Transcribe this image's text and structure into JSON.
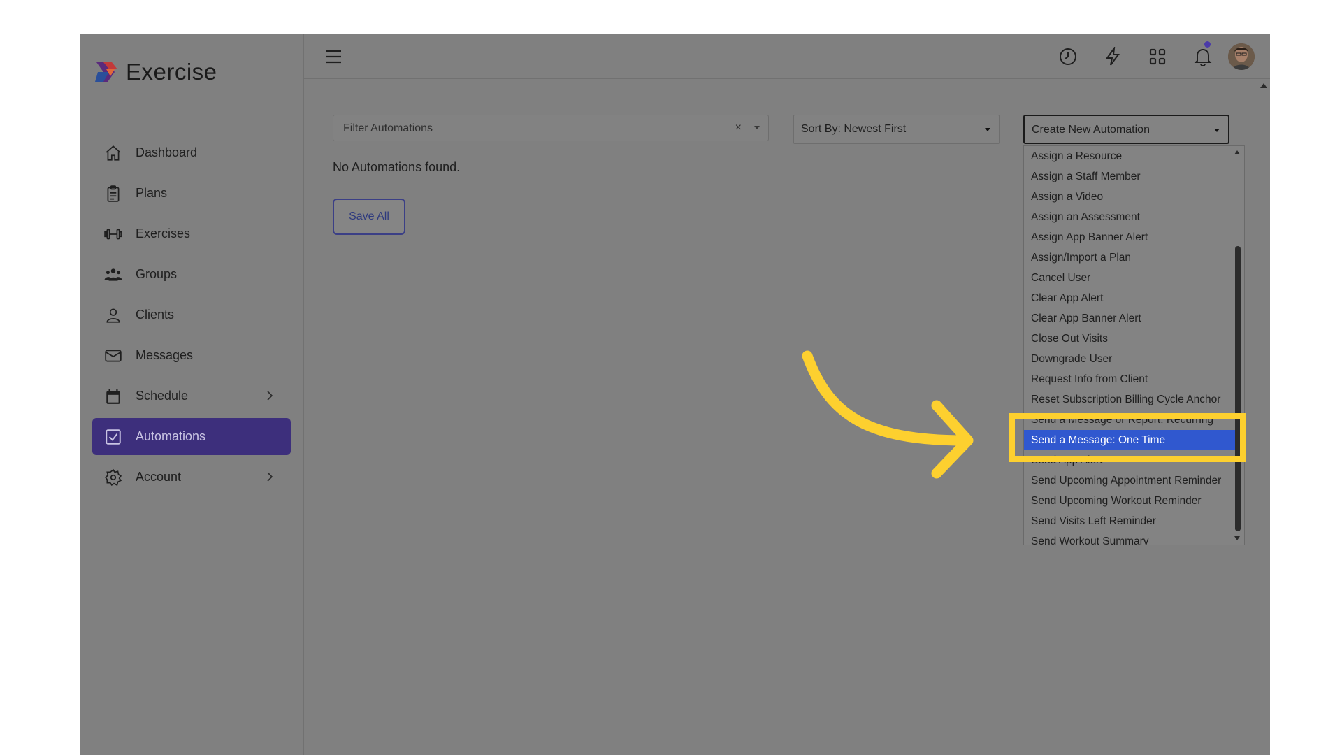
{
  "app": {
    "name": "Exercise"
  },
  "sidebar": {
    "items": [
      {
        "label": "Dashboard",
        "icon": "home-icon"
      },
      {
        "label": "Plans",
        "icon": "clipboard-icon"
      },
      {
        "label": "Exercises",
        "icon": "dumbbell-icon"
      },
      {
        "label": "Groups",
        "icon": "users-icon"
      },
      {
        "label": "Clients",
        "icon": "user-icon"
      },
      {
        "label": "Messages",
        "icon": "mail-icon"
      },
      {
        "label": "Schedule",
        "icon": "calendar-icon"
      },
      {
        "label": "Automations",
        "icon": "checkbox-icon"
      },
      {
        "label": "Account",
        "icon": "gear-icon"
      }
    ],
    "active": "Automations"
  },
  "topbar": {
    "icons": [
      "menu-icon",
      "clock-icon",
      "lightning-icon",
      "grid-icon",
      "bell-icon",
      "avatar"
    ]
  },
  "main": {
    "filter": {
      "placeholder": "Filter Automations",
      "clear_label": "×"
    },
    "sort": {
      "value": "Sort By: Newest First"
    },
    "create": {
      "value": "Create New Automation"
    },
    "empty_text": "No Automations found.",
    "save_all_label": "Save All"
  },
  "dropdown": {
    "options": [
      "Assign a Resource",
      "Assign a Staff Member",
      "Assign a Video",
      "Assign an Assessment",
      "Assign App Banner Alert",
      "Assign/Import a Plan",
      "Cancel User",
      "Clear App Alert",
      "Clear App Banner Alert",
      "Close Out Visits",
      "Downgrade User",
      "Request Info from Client",
      "Reset Subscription Billing Cycle Anchor",
      "Send a Message or Report: Recurring",
      "Send a Message: One Time",
      "Send App Alert",
      "Send Upcoming Appointment Reminder",
      "Send Upcoming Workout Reminder",
      "Send Visits Left Reminder",
      "Send Workout Summary"
    ],
    "selected": "Send a Message: One Time"
  },
  "colors": {
    "accent": "#3d2f7c",
    "selected": "#3058cf",
    "highlight": "#fdd02f",
    "overlay": "#808080"
  }
}
